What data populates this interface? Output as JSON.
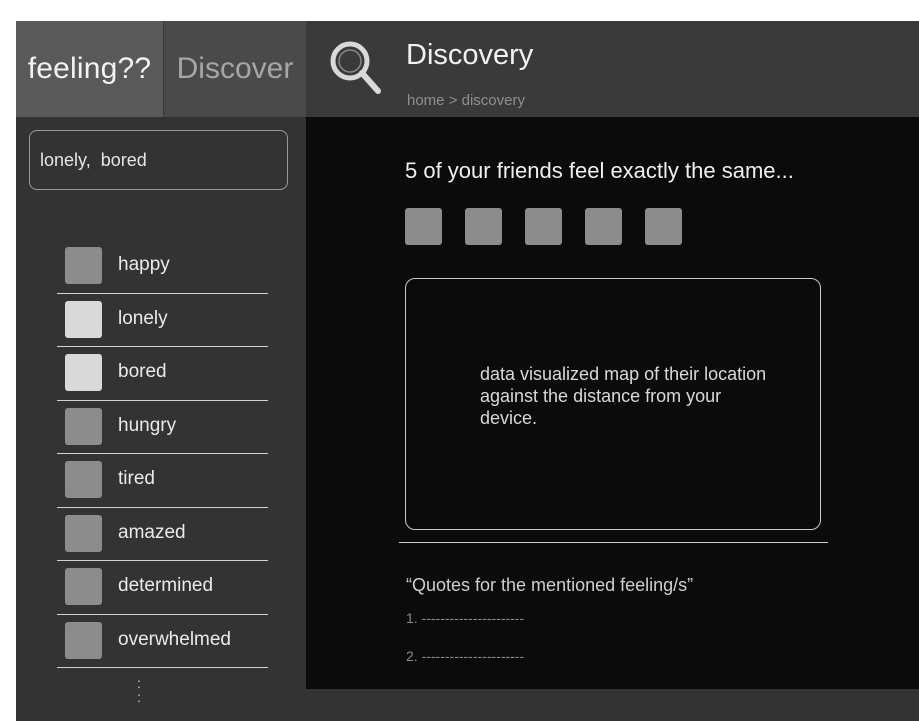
{
  "sidebar": {
    "tabs": [
      {
        "label": "feeling??"
      },
      {
        "label": "Discover"
      }
    ],
    "search_value": "lonely,  bored",
    "feelings": [
      {
        "label": "happy",
        "selected": false
      },
      {
        "label": "lonely",
        "selected": true
      },
      {
        "label": "bored",
        "selected": true
      },
      {
        "label": "hungry",
        "selected": false
      },
      {
        "label": "tired",
        "selected": false
      },
      {
        "label": "amazed",
        "selected": false
      },
      {
        "label": "determined",
        "selected": false
      },
      {
        "label": "overwhelmed",
        "selected": false
      }
    ],
    "more_indicator": ":\n:"
  },
  "header": {
    "icon": "search-icon",
    "title": "Discovery",
    "breadcrumb": "home > discovery"
  },
  "main": {
    "friends_heading": "5 of your friends feel exactly the same...",
    "friend_count": 5,
    "map_placeholder": "data visualized map of their location against the distance from your device.",
    "quotes_title": "“Quotes for the mentioned feeling/s”",
    "quotes": [
      "1. ----------------------",
      "2. ----------------------"
    ]
  },
  "colors": {
    "frame_bg": "#0b0b0b",
    "sidebar_bg": "#333333",
    "header_bg": "#3a3a3a",
    "active_tab_bg": "#595959",
    "checkbox_unselected": "#8c8c8c",
    "checkbox_selected": "#d9d9d9"
  }
}
